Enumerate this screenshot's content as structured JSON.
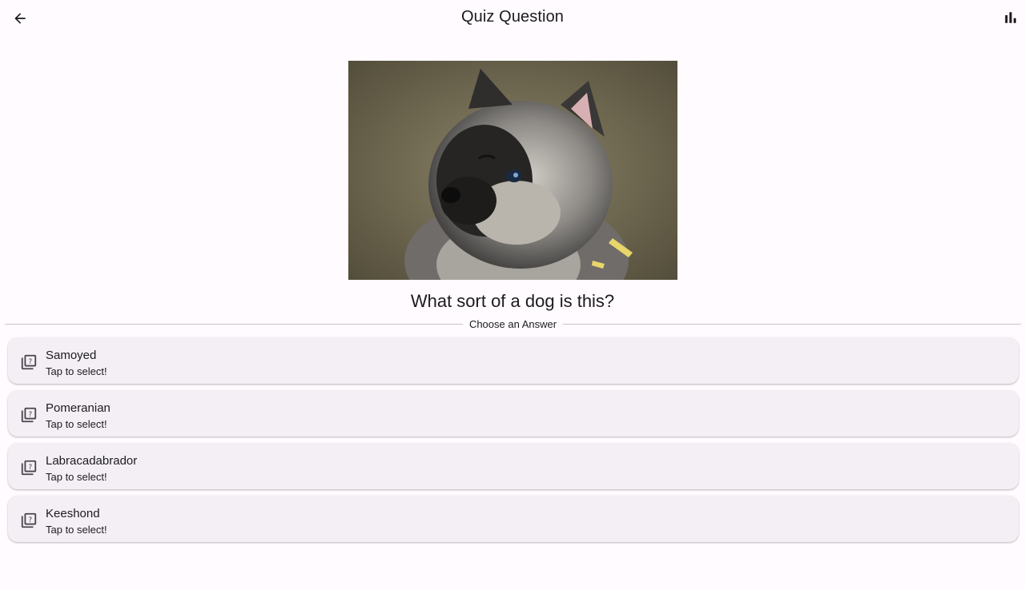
{
  "header": {
    "title": "Quiz Question",
    "back_icon": "arrow-back-icon",
    "stats_icon": "bar-chart-icon"
  },
  "question": {
    "image": "dog-photo",
    "text": "What sort of a dog is this?"
  },
  "answers_section": {
    "label": "Choose an Answer",
    "icon": "quiz-icon",
    "options": [
      {
        "label": "Samoyed",
        "subtitle": "Tap to select!"
      },
      {
        "label": "Pomeranian",
        "subtitle": "Tap to select!"
      },
      {
        "label": "Labracadabrador",
        "subtitle": "Tap to select!"
      },
      {
        "label": "Keeshond",
        "subtitle": "Tap to select!"
      }
    ]
  },
  "colors": {
    "background": "#fffbfe",
    "card": "#f4eff4",
    "text": "#1c1b1f",
    "divider": "#cac4d0"
  }
}
